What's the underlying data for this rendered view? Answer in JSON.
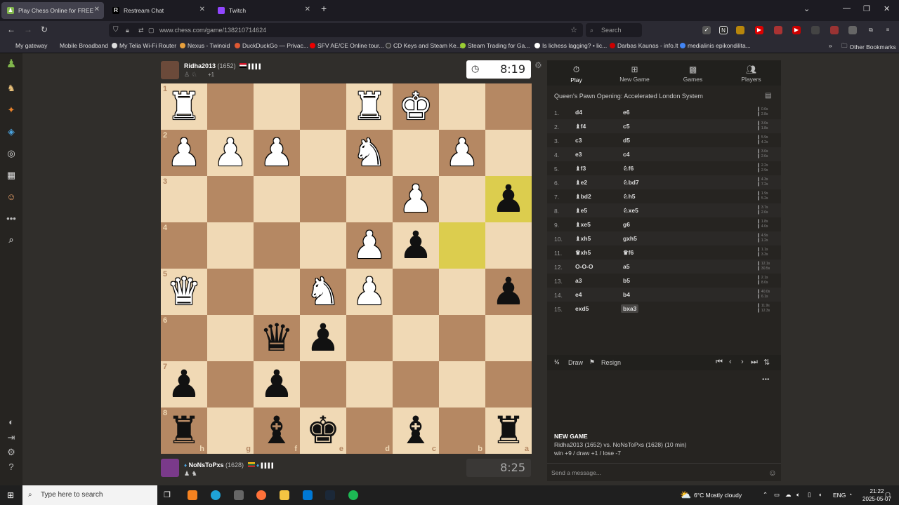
{
  "browser": {
    "tabs": [
      {
        "title": "Play Chess Online for FREE",
        "active": true
      },
      {
        "title": "Restream Chat",
        "active": false
      },
      {
        "title": "Twitch",
        "active": false
      }
    ],
    "url": "www.chess.com/game/138210714624",
    "search_placeholder": "Search",
    "bookmarks": [
      "My gateway",
      "Mobile Broadband",
      "My Telia Wi-Fi Router",
      "Nexus - Twinoid",
      "DuckDuckGo — Privac...",
      "SFV AE/CE Online tour...",
      "CD Keys and Steam Ke...",
      "Steam Trading for Ga...",
      "Is lichess lagging? • lic...",
      "Darbas Kaunas - info.lt",
      "medialinis epikondilita...",
      "Other Bookmarks"
    ]
  },
  "top_player": {
    "name": "Ridha2013",
    "rating": "(1652)",
    "captured": "+1",
    "clock": "8:19"
  },
  "bottom_player": {
    "name": "NoNsToPxs",
    "rating": "(1628)",
    "clock": "8:25"
  },
  "board": {
    "ranks": [
      "1",
      "2",
      "3",
      "4",
      "5",
      "6",
      "7",
      "8"
    ],
    "files": [
      "h",
      "g",
      "f",
      "e",
      "d",
      "c",
      "b",
      "a"
    ],
    "pieces": [
      [
        "wR",
        "",
        "",
        "",
        "wR",
        "wK",
        "",
        ""
      ],
      [
        "wP",
        "wP",
        "wP",
        "",
        "wN",
        "",
        "wP",
        ""
      ],
      [
        "",
        "",
        "",
        "",
        "",
        "wP",
        "",
        "bP"
      ],
      [
        "",
        "",
        "",
        "",
        "wP",
        "bP",
        "",
        ""
      ],
      [
        "wQ",
        "",
        "",
        "wN",
        "wP",
        "",
        "",
        "bP"
      ],
      [
        "",
        "",
        "bQ",
        "bP",
        "",
        "",
        "",
        ""
      ],
      [
        "bP",
        "",
        "bP",
        "",
        "",
        "",
        "",
        ""
      ],
      [
        "bR",
        "",
        "bB",
        "bK",
        "",
        "bB",
        "",
        "bR"
      ]
    ],
    "highlights": [
      [
        2,
        7
      ],
      [
        3,
        6
      ]
    ]
  },
  "panel": {
    "tabs": [
      {
        "label": "Play",
        "icon": "stopwatch-icon"
      },
      {
        "label": "New Game",
        "icon": "plus-icon"
      },
      {
        "label": "Games",
        "icon": "board-icon"
      },
      {
        "label": "Players",
        "icon": "players-icon"
      }
    ],
    "opening": "Queen's Pawn Opening: Accelerated London System",
    "moves": [
      {
        "n": "1.",
        "w": "d4",
        "b": "e6",
        "wt": "0.6s",
        "bt": "2.8s"
      },
      {
        "n": "2.",
        "w": "♝f4",
        "b": "c5",
        "wt": "3.0s",
        "bt": "1.8s"
      },
      {
        "n": "3.",
        "w": "c3",
        "b": "d5",
        "wt": "5.9s",
        "bt": "4.2s"
      },
      {
        "n": "4.",
        "w": "e3",
        "b": "c4",
        "wt": "3.6s",
        "bt": "2.6s"
      },
      {
        "n": "5.",
        "w": "♝f3",
        "b": "♘f6",
        "wt": "2.2s",
        "bt": "2.9s"
      },
      {
        "n": "6.",
        "w": "♝e2",
        "b": "♘bd7",
        "wt": "4.3s",
        "bt": "7.2s"
      },
      {
        "n": "7.",
        "w": "♝bd2",
        "b": "♘h5",
        "wt": "1.9s",
        "bt": "5.2s"
      },
      {
        "n": "8.",
        "w": "♝e5",
        "b": "♘xe5",
        "wt": "3.7s",
        "bt": "2.6s"
      },
      {
        "n": "9.",
        "w": "♝xe5",
        "b": "g6",
        "wt": "1.8s",
        "bt": "4.0s"
      },
      {
        "n": "10.",
        "w": "♝xh5",
        "b": "gxh5",
        "wt": "4.9s",
        "bt": "1.2s"
      },
      {
        "n": "11.",
        "w": "♛xh5",
        "b": "♛f6",
        "wt": "1.1s",
        "bt": "3.3s"
      },
      {
        "n": "12.",
        "w": "O-O-O",
        "b": "a5",
        "wt": "12.1s",
        "bt": "30.5s"
      },
      {
        "n": "13.",
        "w": "a3",
        "b": "b5",
        "wt": "2.1s",
        "bt": "8.0s"
      },
      {
        "n": "14.",
        "w": "e4",
        "b": "b4",
        "wt": "40.0s",
        "bt": "6.1s"
      },
      {
        "n": "15.",
        "w": "exd5",
        "b": "bxa3",
        "wt": "11.9s",
        "bt": "12.3s"
      }
    ],
    "draw_label": "Draw",
    "resign_label": "Resign",
    "draw_prefix": "½",
    "info_title": "NEW GAME",
    "info_line": "Ridha2013 (1652) vs. NoNsToPxs (1628) (10 min)",
    "info_score": "win +9 / draw +1 / lose -7",
    "chat_placeholder": "Send a message..."
  },
  "taskbar": {
    "search_placeholder": "Type here to search",
    "weather": "6°C  Mostly cloudy",
    "lang": "ENG",
    "time": "21:22",
    "date": "2025-05-07"
  },
  "colors": {
    "light": "#f0d9b5",
    "dark": "#b58863",
    "highlight": "#dccd4e",
    "accent": "#81b64c"
  }
}
